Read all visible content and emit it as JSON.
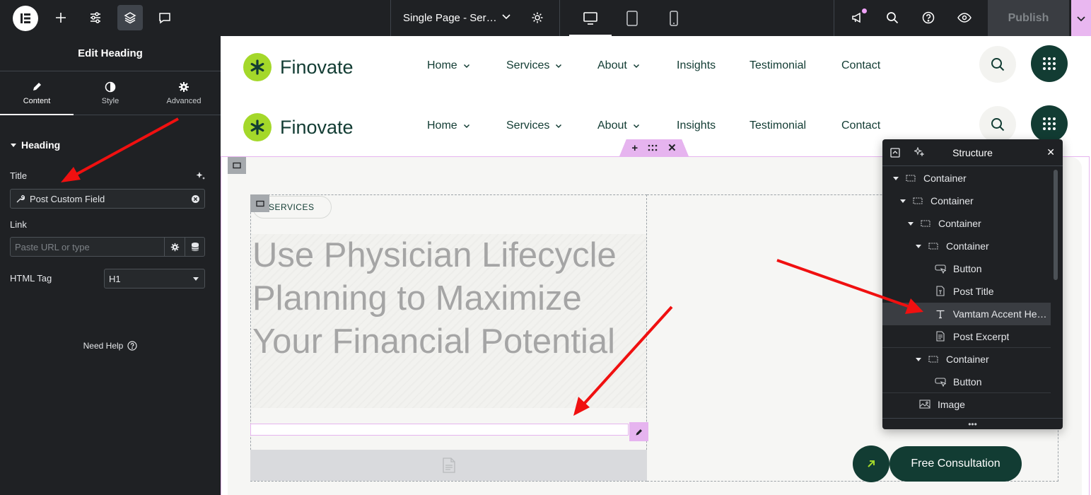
{
  "topbar": {
    "document_title": "Single Page - Ser…",
    "publish_label": "Publish"
  },
  "panel": {
    "header": "Edit Heading",
    "tabs": [
      {
        "label": "Content",
        "icon": "pencil-icon"
      },
      {
        "label": "Style",
        "icon": "half-circle-icon"
      },
      {
        "label": "Advanced",
        "icon": "gear-icon"
      }
    ],
    "section_title": "Heading",
    "title_label": "Title",
    "title_value": "Post Custom Field",
    "link_label": "Link",
    "link_placeholder": "Paste URL or type",
    "html_tag_label": "HTML Tag",
    "html_tag_value": "H1",
    "need_help": "Need Help"
  },
  "site": {
    "brand": "Finovate",
    "nav": [
      {
        "label": "Home",
        "has_dropdown": true
      },
      {
        "label": "Services",
        "has_dropdown": true
      },
      {
        "label": "About",
        "has_dropdown": true
      },
      {
        "label": "Insights",
        "has_dropdown": false
      },
      {
        "label": "Testimonial",
        "has_dropdown": false
      },
      {
        "label": "Contact",
        "has_dropdown": false
      }
    ],
    "pill_label": "SERVICES",
    "headline": "Use Physician Lifecycle Planning to Maximize Your Financial Potential",
    "cta_label": "Free Consultation"
  },
  "structure": {
    "title": "Structure",
    "items": [
      {
        "label": "Container",
        "icon": "container-icon"
      },
      {
        "label": "Container",
        "icon": "container-icon"
      },
      {
        "label": "Container",
        "icon": "container-icon"
      },
      {
        "label": "Container",
        "icon": "container-icon"
      },
      {
        "label": "Button",
        "icon": "button-icon"
      },
      {
        "label": "Post Title",
        "icon": "post-title-icon"
      },
      {
        "label": "Vamtam Accent Hea…",
        "icon": "heading-icon"
      },
      {
        "label": "Post Excerpt",
        "icon": "post-excerpt-icon"
      },
      {
        "label": "Container",
        "icon": "container-icon"
      },
      {
        "label": "Button",
        "icon": "button-icon"
      },
      {
        "label": "Image",
        "icon": "image-icon"
      }
    ]
  },
  "colors": {
    "editor_dark": "#1f2124",
    "accent_pink": "#e6b4ef",
    "brand_green": "#123c33",
    "brand_lime": "#a4d82a",
    "annotation_red": "#f01010"
  }
}
